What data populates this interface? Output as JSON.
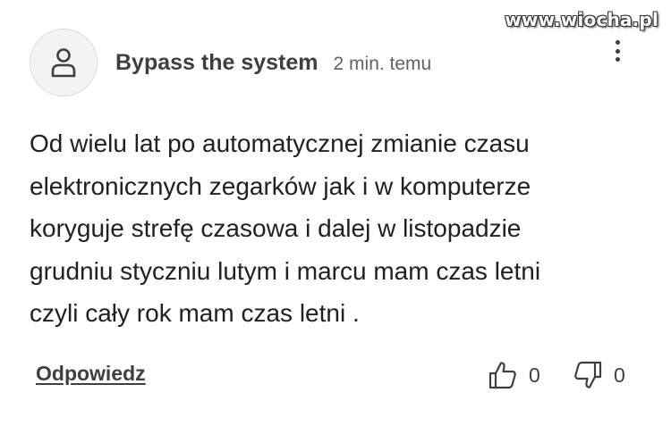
{
  "watermark": "www.wiocha.pl",
  "comment": {
    "author": "Bypass the system",
    "time": "2 min. temu",
    "avatar_icon": "user-icon",
    "more_icon": "more-vertical-icon",
    "lines": [
      "Od wielu lat po automatycznej zmianie czasu",
      "elektronicznych zegarków jak i w komputerze",
      "koryguje strefę czasowa i dalej w listopadzie",
      "grudniu styczniu lutym i marcu mam czas letni",
      "czyli cały rok mam czas letni ."
    ]
  },
  "actions": {
    "reply_label": "Odpowiedz",
    "like_icon": "thumbs-up-icon",
    "like_count": "0",
    "dislike_icon": "thumbs-down-icon",
    "dislike_count": "0"
  }
}
